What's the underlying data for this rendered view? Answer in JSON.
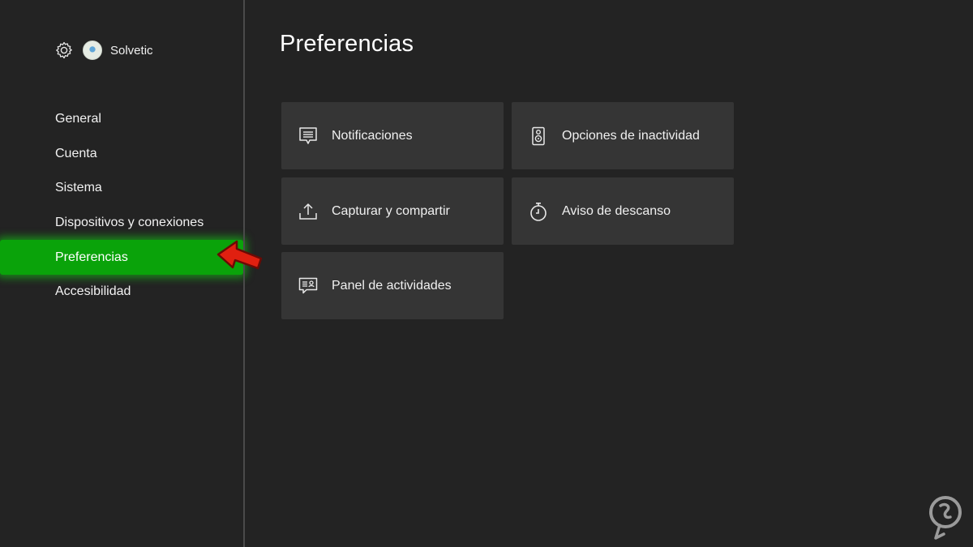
{
  "profile": {
    "name": "Solvetic"
  },
  "sidebar": {
    "items": [
      {
        "label": "General"
      },
      {
        "label": "Cuenta"
      },
      {
        "label": "Sistema"
      },
      {
        "label": "Dispositivos y conexiones"
      },
      {
        "label": "Preferencias",
        "active": true
      },
      {
        "label": "Accesibilidad"
      }
    ]
  },
  "main": {
    "title": "Preferencias",
    "tiles": [
      {
        "label": "Notificaciones",
        "icon": "notifications-icon"
      },
      {
        "label": "Opciones de inactividad",
        "icon": "idle-options-icon"
      },
      {
        "label": "Capturar y compartir",
        "icon": "share-upload-icon"
      },
      {
        "label": "Aviso de descanso",
        "icon": "timer-icon"
      },
      {
        "label": "Panel de actividades",
        "icon": "activity-feed-icon"
      }
    ]
  },
  "colors": {
    "background": "#232323",
    "tile": "#353535",
    "active_highlight": "#0aa30a",
    "annotation_arrow": "#e02010"
  }
}
